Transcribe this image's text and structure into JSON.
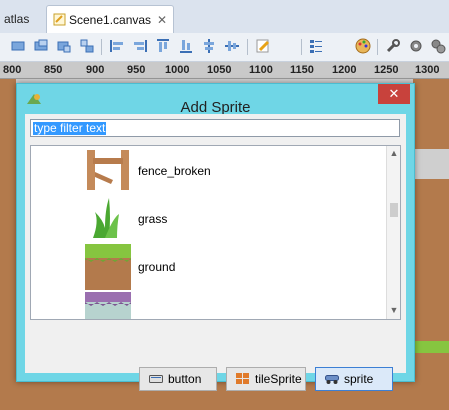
{
  "tabs": [
    {
      "label": "atlas"
    },
    {
      "label": "Scene1.canvas",
      "close": "✕"
    }
  ],
  "ruler": {
    "ticks": [
      "800",
      "850",
      "900",
      "950",
      "1000",
      "1050",
      "1100",
      "1150",
      "1200",
      "1250",
      "1300"
    ]
  },
  "toolbar": {
    "icons": [
      "align-left-icon",
      "align-center-icon",
      "align-right-icon",
      "align-top-icon",
      "align-middle-icon",
      "align-bottom-icon",
      "align-h-icon",
      "align-v-icon",
      "align-distribute-icon",
      "pencil-icon",
      "add-sprite-icon",
      "properties-icon",
      "layout-icon",
      "palette-icon",
      "wrench-icon",
      "gear-icon",
      "gears-icon"
    ],
    "active_icon": "add-sprite-icon"
  },
  "dialog": {
    "title": "Add Sprite",
    "close": "✕",
    "filter_text": "type filter text",
    "items": [
      {
        "label": "fence_broken",
        "icon": "fence-broken-icon"
      },
      {
        "label": "grass",
        "icon": "grass-icon"
      },
      {
        "label": "ground",
        "icon": "ground-icon"
      },
      {
        "label": "",
        "icon": "ground-purple-icon"
      }
    ],
    "buttons": [
      {
        "label": "button",
        "icon": "button-icon"
      },
      {
        "label": "tileSprite",
        "icon": "tilesprite-icon"
      },
      {
        "label": "sprite",
        "icon": "sprite-icon"
      }
    ]
  },
  "colors": {
    "dialog_frame": "#6fd6e6",
    "close": "#c8423c",
    "selection": "#3399ff",
    "highlight": "#e53935"
  }
}
